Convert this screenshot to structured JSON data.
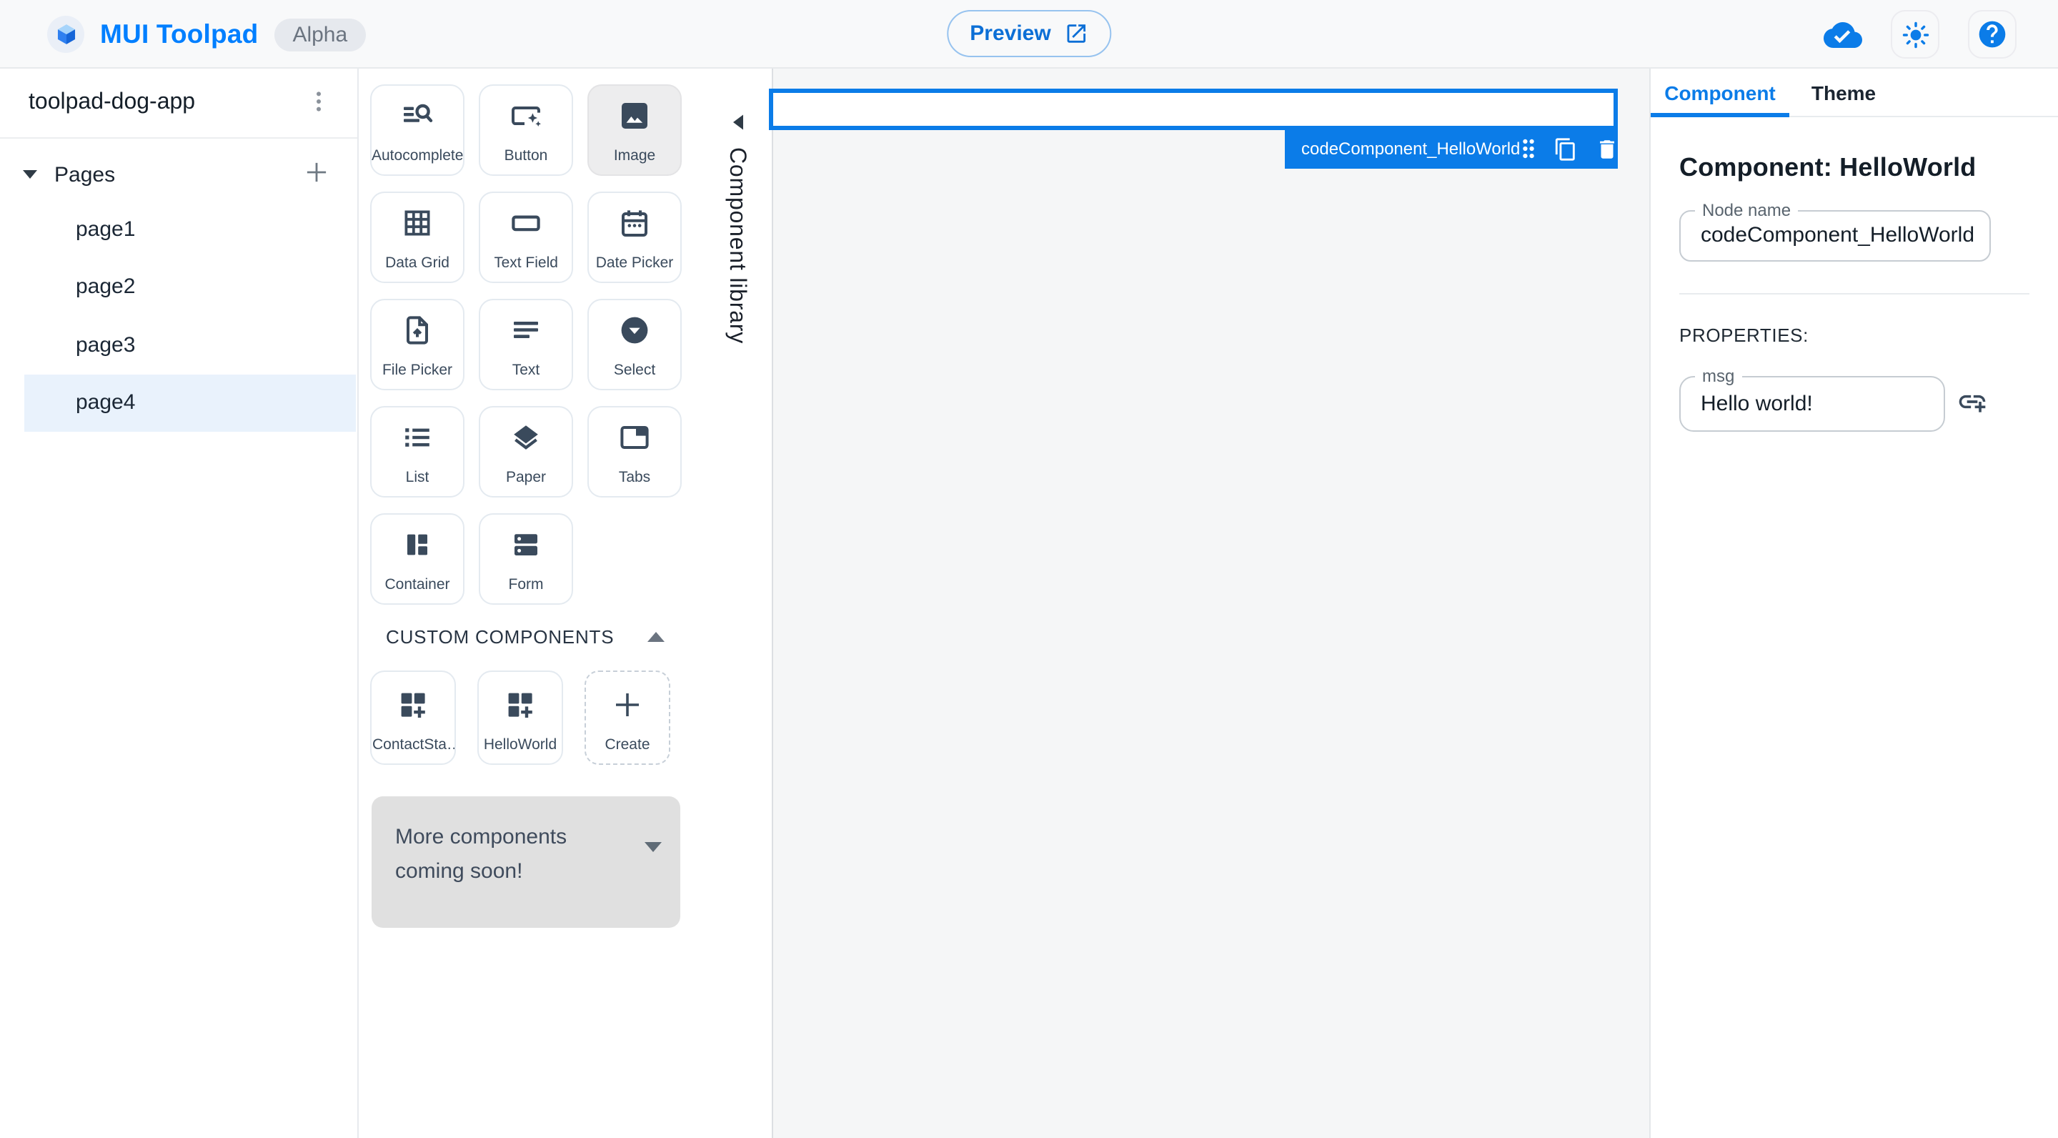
{
  "topbar": {
    "app_title": "MUI Toolpad",
    "badge": "Alpha",
    "preview_label": "Preview"
  },
  "sidebar": {
    "app_name": "toolpad-dog-app",
    "pages_label": "Pages",
    "pages": [
      "page1",
      "page2",
      "page3",
      "page4"
    ],
    "selected_page": "page4"
  },
  "library": {
    "title": "Component library",
    "components": [
      "Autocomplete",
      "Button",
      "Image",
      "Data Grid",
      "Text Field",
      "Date Picker",
      "File Picker",
      "Text",
      "Select",
      "List",
      "Paper",
      "Tabs",
      "Container",
      "Form"
    ],
    "selected_component": "Image",
    "custom_header": "CUSTOM COMPONENTS",
    "custom_components": [
      "ContactSta…",
      "HelloWorld"
    ],
    "create_label": "Create",
    "banner_text": "More components coming soon!"
  },
  "canvas": {
    "selection_label": "codeComponent_HelloWorld"
  },
  "inspector": {
    "tabs": [
      "Component",
      "Theme"
    ],
    "active_tab": "Component",
    "heading": "Component: HelloWorld",
    "node_name_label": "Node name",
    "node_name_value": "codeComponent_HelloWorld",
    "properties_label": "PROPERTIES:",
    "msg_label": "msg",
    "msg_value": "Hello world!"
  },
  "colors": {
    "accent": "#0b7ce8",
    "brand": "#007fff",
    "ink": "#3a4a5c",
    "selected_page_bg": "#e9f2fc"
  }
}
